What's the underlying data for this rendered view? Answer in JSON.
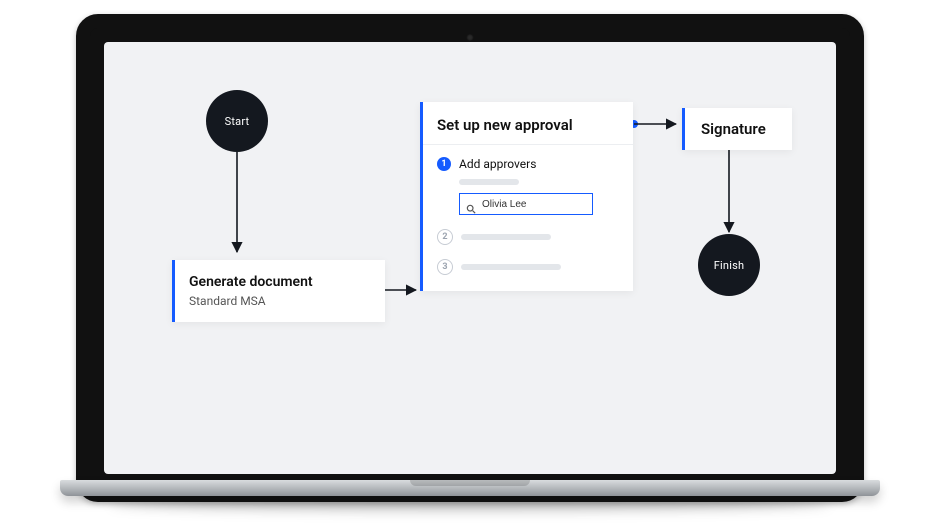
{
  "flow": {
    "start_label": "Start",
    "finish_label": "Finish",
    "generate": {
      "title": "Generate document",
      "subtitle": "Standard MSA"
    },
    "approval": {
      "title": "Set up new approval",
      "step1": {
        "number": "1",
        "label": "Add approvers"
      },
      "step2": {
        "number": "2"
      },
      "step3": {
        "number": "3"
      },
      "search_value": "Olivia Lee"
    },
    "signature": {
      "title": "Signature"
    }
  }
}
